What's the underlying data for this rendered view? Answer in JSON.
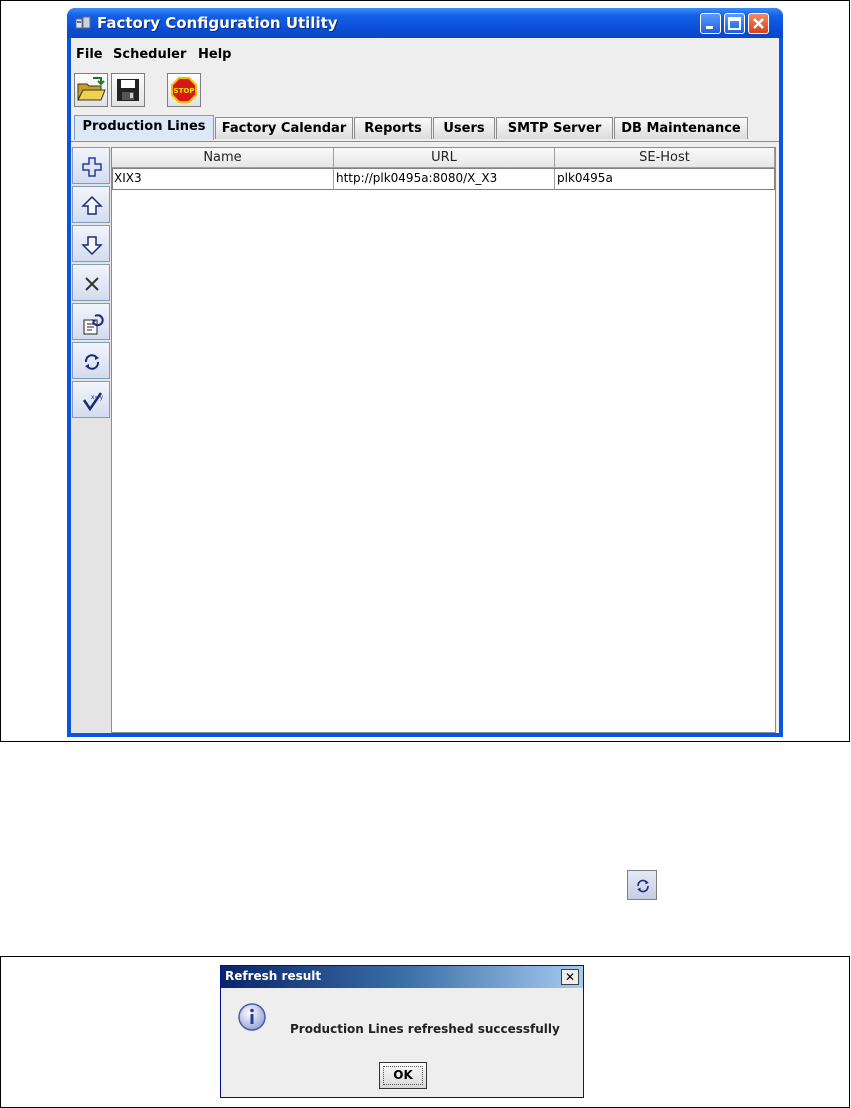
{
  "window": {
    "title": "Factory Configuration Utility"
  },
  "menu": {
    "items": [
      "File",
      "Scheduler",
      "Help"
    ]
  },
  "toolbar": {
    "icons": [
      "open-folder-icon",
      "save-disk-icon",
      "stop-sign-icon"
    ],
    "stop_label": "STOP"
  },
  "tabs": [
    {
      "label": "Production Lines",
      "active": true
    },
    {
      "label": "Factory Calendar",
      "active": false
    },
    {
      "label": "Reports",
      "active": false
    },
    {
      "label": "Users",
      "active": false
    },
    {
      "label": "SMTP Server",
      "active": false
    },
    {
      "label": "DB Maintenance",
      "active": false
    }
  ],
  "side_toolbar": {
    "icons": [
      "add-icon",
      "move-up-icon",
      "move-down-icon",
      "delete-icon",
      "edit-refresh-icon",
      "refresh-icon",
      "validate-icon"
    ]
  },
  "table": {
    "columns": [
      "Name",
      "URL",
      "SE-Host"
    ],
    "rows": [
      [
        "XIX3",
        "http://plk0495a:8080/X_X3",
        "plk0495a"
      ]
    ]
  },
  "colors": {
    "titlebar": "#0a54e3",
    "window_bg": "#eeeeee",
    "dialog_title": "#0a246a"
  },
  "dialog": {
    "title": "Refresh result",
    "message": "Production Lines refreshed successfully",
    "ok_label": "OK",
    "close_label": "✕",
    "icon": "info-icon"
  }
}
